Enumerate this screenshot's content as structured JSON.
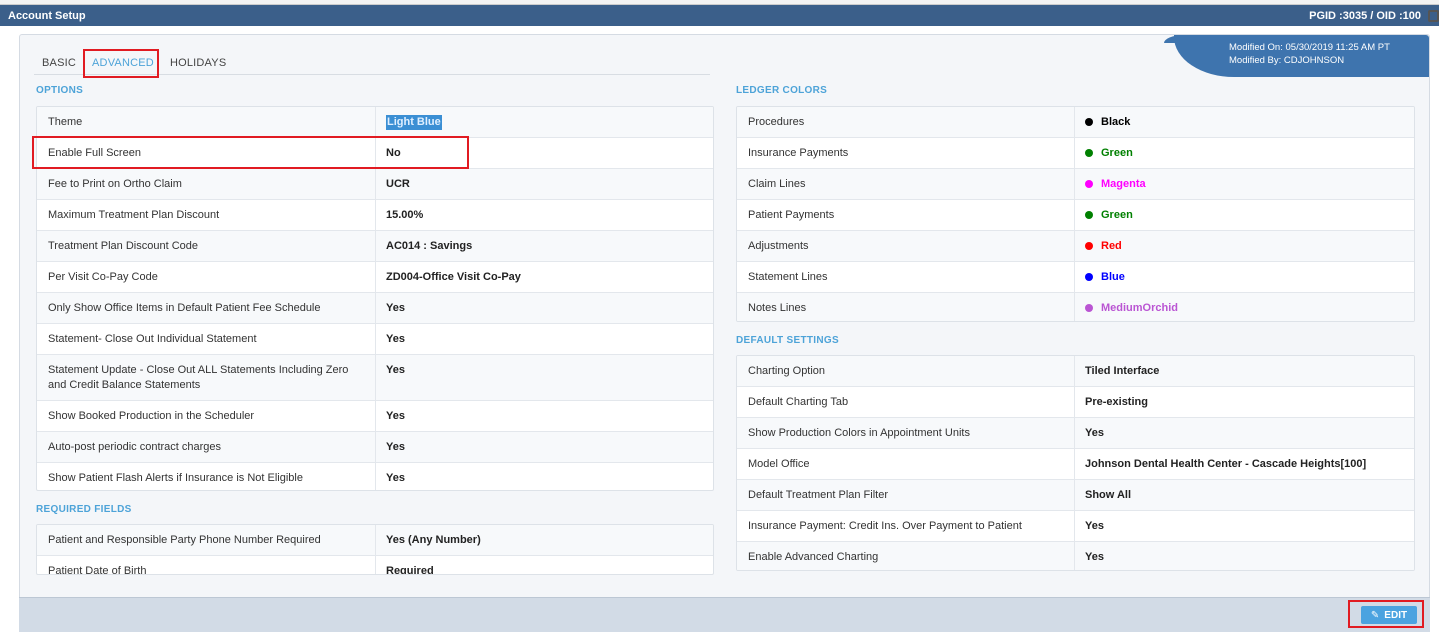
{
  "header": {
    "title": "Account Setup",
    "ids": "PGID :3035  /  OID :100"
  },
  "tabs": [
    {
      "label": "BASIC",
      "active": false
    },
    {
      "label": "ADVANCED",
      "active": true
    },
    {
      "label": "HOLIDAYS",
      "active": false
    }
  ],
  "modified": {
    "on": "Modified On: 05/30/2019 11:25 AM PT",
    "by": "Modified By: CDJOHNSON"
  },
  "options": {
    "title": "OPTIONS",
    "rows": [
      {
        "label": "Theme",
        "value": "Light Blue"
      },
      {
        "label": "Enable Full Screen",
        "value": "No"
      },
      {
        "label": "Fee to Print on Ortho Claim",
        "value": "UCR"
      },
      {
        "label": "Maximum Treatment Plan Discount",
        "value": "15.00%"
      },
      {
        "label": "Treatment Plan Discount Code",
        "value": "AC014 : Savings"
      },
      {
        "label": "Per Visit Co-Pay Code",
        "value": "ZD004-Office Visit Co-Pay"
      },
      {
        "label": "Only Show Office Items in Default Patient Fee Schedule",
        "value": "Yes"
      },
      {
        "label": "Statement- Close Out Individual Statement",
        "value": "Yes"
      },
      {
        "label": "Statement Update - Close Out ALL Statements Including Zero and Credit Balance Statements",
        "value": "Yes"
      },
      {
        "label": "Show Booked Production in the Scheduler",
        "value": "Yes"
      },
      {
        "label": "Auto-post periodic contract charges",
        "value": "Yes"
      },
      {
        "label": "Show Patient Flash Alerts if Insurance is Not Eligible",
        "value": "Yes"
      }
    ]
  },
  "required_fields": {
    "title": "REQUIRED FIELDS",
    "rows": [
      {
        "label": "Patient and Responsible Party Phone Number Required",
        "value": "Yes (Any Number)"
      },
      {
        "label": "Patient Date of Birth",
        "value": "Required"
      }
    ]
  },
  "ledger_colors": {
    "title": "LEDGER COLORS",
    "rows": [
      {
        "label": "Procedures",
        "value": "Black",
        "color": "#000000"
      },
      {
        "label": "Insurance Payments",
        "value": "Green",
        "color": "#008000"
      },
      {
        "label": "Claim Lines",
        "value": "Magenta",
        "color": "#ff00ff"
      },
      {
        "label": "Patient Payments",
        "value": "Green",
        "color": "#008000"
      },
      {
        "label": "Adjustments",
        "value": "Red",
        "color": "#ff0000"
      },
      {
        "label": "Statement Lines",
        "value": "Blue",
        "color": "#0000ff"
      },
      {
        "label": "Notes Lines",
        "value": "MediumOrchid",
        "color": "#ba55d3"
      }
    ]
  },
  "default_settings": {
    "title": "DEFAULT SETTINGS",
    "rows": [
      {
        "label": "Charting Option",
        "value": "Tiled Interface"
      },
      {
        "label": "Default Charting Tab",
        "value": "Pre-existing"
      },
      {
        "label": "Show Production Colors in Appointment Units",
        "value": "Yes"
      },
      {
        "label": "Model Office",
        "value": "Johnson Dental Health Center - Cascade Heights[100]"
      },
      {
        "label": "Default Treatment Plan Filter",
        "value": "Show All"
      },
      {
        "label": "Insurance Payment: Credit Ins. Over Payment to Patient",
        "value": "Yes"
      },
      {
        "label": "Enable Advanced Charting",
        "value": "Yes"
      }
    ]
  },
  "footer": {
    "edit_label": "EDIT"
  }
}
